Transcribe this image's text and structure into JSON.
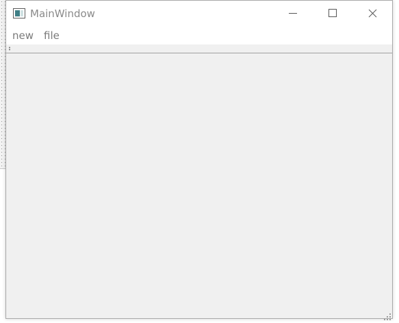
{
  "window": {
    "title": "MainWindow",
    "icon": "qt-window-icon",
    "controls": {
      "minimize_icon": "minimize-icon",
      "maximize_icon": "maximize-icon",
      "close_icon": "close-icon"
    }
  },
  "menubar": {
    "items": [
      {
        "label": "new"
      },
      {
        "label": "file"
      }
    ]
  },
  "toolbar": {
    "grip_icon": "toolbar-grip-icon"
  },
  "statusbar": {
    "size_grip_icon": "size-grip-icon"
  },
  "colors": {
    "titlebar_bg": "#ffffff",
    "client_bg": "#f0f0f0",
    "text": "#7a7a7a",
    "accent_icon": "#3f7f86"
  }
}
